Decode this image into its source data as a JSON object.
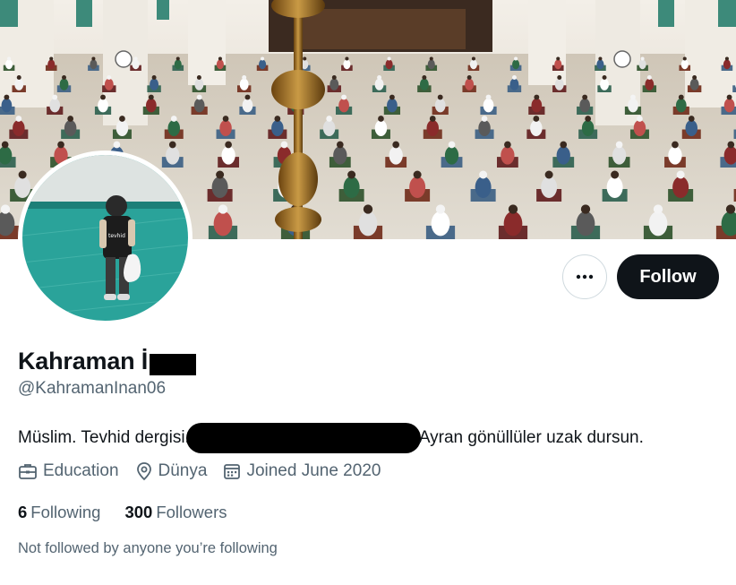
{
  "profile": {
    "display_name": "Kahraman İ",
    "handle": "@KahramanInan06",
    "bio_before": "Müslim. Tevhid dergisi.",
    "bio_after": "Ayran gönüllüler uzak dursun.",
    "category": "Education",
    "location": "Dünya",
    "joined": "Joined June 2020",
    "following_count": "6",
    "following_label": "Following",
    "followers_count": "300",
    "followers_label": "Followers",
    "not_followed_note": "Not followed by anyone you’re following"
  },
  "actions": {
    "follow_label": "Follow",
    "more_icon": "more-dots-icon"
  },
  "icons": {
    "category": "briefcase-icon",
    "location": "location-pin-icon",
    "joined": "calendar-icon"
  },
  "colors": {
    "primary_text": "#0f1419",
    "secondary_text": "#536471",
    "follow_button": "#0f1419"
  },
  "avatar_text": "tevhid"
}
